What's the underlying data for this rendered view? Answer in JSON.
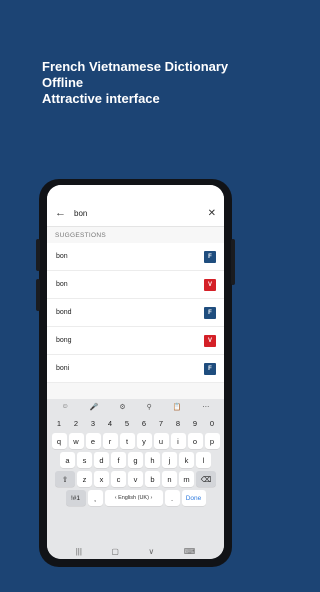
{
  "promo": {
    "line1": "French Vietnamese Dictionary",
    "line2": "Offline",
    "line3": "Attractive interface"
  },
  "search": {
    "query": "bon",
    "back_icon": "arrow-left-icon",
    "clear_icon": "close-icon"
  },
  "suggestions": {
    "label": "SUGGESTIONS",
    "items": [
      {
        "word": "bon",
        "badge": "F",
        "badge_color": "#1f4d7e"
      },
      {
        "word": "bon",
        "badge": "V",
        "badge_color": "#d42027"
      },
      {
        "word": "bond",
        "badge": "F",
        "badge_color": "#1f4d7e"
      },
      {
        "word": "bong",
        "badge": "V",
        "badge_color": "#d42027"
      },
      {
        "word": "boni",
        "badge": "F",
        "badge_color": "#1f4d7e"
      }
    ]
  },
  "keyboard": {
    "toolbar": [
      "emoji-icon",
      "mic-icon",
      "settings-icon",
      "search-icon",
      "clipboard-icon",
      "more-icon"
    ],
    "numbers": [
      "1",
      "2",
      "3",
      "4",
      "5",
      "6",
      "7",
      "8",
      "9",
      "0"
    ],
    "row1": [
      "q",
      "w",
      "e",
      "r",
      "t",
      "y",
      "u",
      "i",
      "o",
      "p"
    ],
    "row2": [
      "a",
      "s",
      "d",
      "f",
      "g",
      "h",
      "j",
      "k",
      "l"
    ],
    "row3": [
      "z",
      "x",
      "c",
      "v",
      "b",
      "n",
      "m"
    ],
    "symbols_key": "!#1",
    "comma_key": ",",
    "space_label": "English (UK)",
    "period_key": ".",
    "done_key": "Done",
    "done_color": "#2f7bdf"
  },
  "navbar": [
    "recents-icon",
    "home-icon",
    "back-icon",
    "keyboard-icon"
  ]
}
